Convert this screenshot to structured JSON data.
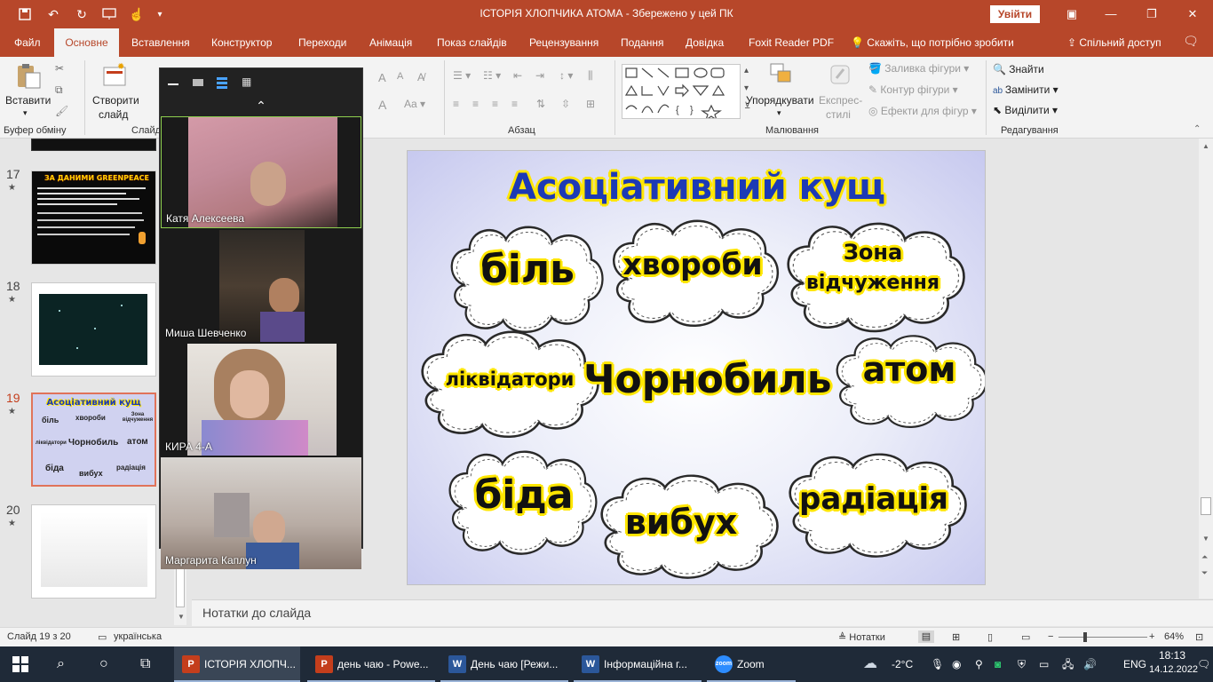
{
  "window": {
    "title": "ІСТОРІЯ ХЛОПЧИКА АТОМА  -  Збережено у цей ПК",
    "signin_label": "Увійти"
  },
  "ribbon_tabs": [
    "Файл",
    "Основне",
    "Вставлення",
    "Конструктор",
    "Переходи",
    "Анімація",
    "Показ слайдів",
    "Рецензування",
    "Подання",
    "Довідка",
    "Foxit Reader PDF"
  ],
  "tell_me": "Скажіть, що потрібно зробити",
  "share": "Спільний доступ",
  "ribbon": {
    "paste": "Вставити",
    "clipboard_group": "Буфер обміну",
    "new_slide_line1": "Створити",
    "new_slide_line2": "слайд",
    "slides_group": "Слайд",
    "paragraph_group": "Абзац",
    "arrange": "Упорядкувати",
    "quick_styles_line1": "Експрес-",
    "quick_styles_line2": "стилі",
    "shape_fill": "Заливка фігури",
    "shape_outline": "Контур фігури",
    "shape_effects": "Ефекти для фігур",
    "drawing_group": "Малювання",
    "find": "Знайти",
    "replace": "Замінити",
    "select": "Виділити",
    "editing_group": "Редагування"
  },
  "thumbnails": [
    {
      "number": "17",
      "title": "ЗА ДАНИМИ GREENPEACE"
    },
    {
      "number": "18"
    },
    {
      "number": "19",
      "title": "Асоціативний кущ",
      "words": [
        "біль",
        "хвороби",
        "Зона відчуження",
        "ліквідатори",
        "Чорнобиль",
        "атом",
        "біда",
        "вибух",
        "радіація"
      ]
    },
    {
      "number": "20"
    }
  ],
  "slide": {
    "title": "Асоціативний кущ",
    "center": "Чорнобиль",
    "clouds": {
      "pain": "біль",
      "diseases": "хвороби",
      "zone_line1": "Зона",
      "zone_line2": "відчуження",
      "liquidators": "ліквідатори",
      "atom": "атом",
      "trouble": "біда",
      "explosion": "вибух",
      "radiation": "радіація"
    }
  },
  "notes_placeholder": "Нотатки до слайда",
  "status": {
    "slide_counter": "Слайд 19 з 20",
    "language": "українська",
    "notes_label": "Нотатки",
    "zoom": "64%",
    "zoom_level": 0.64
  },
  "zoom_meeting": {
    "participants": [
      "Катя Алексеева",
      "Миша Шевченко",
      "КИРА 4-А",
      "Маргарита Каплун"
    ]
  },
  "taskbar": {
    "apps": [
      "ІСТОРІЯ ХЛОПЧ...",
      "день чаю - Powe...",
      "День чаю [Режи...",
      "Інформаційна г...",
      "Zoom"
    ],
    "weather": "-2°C",
    "language": "ENG",
    "time": "18:13",
    "date": "14.12.2022"
  },
  "colors": {
    "accent": "#b7472a",
    "slide_title": "#1d3ab5",
    "highlight": "#ffe600",
    "taskbar": "#1f2a38"
  }
}
